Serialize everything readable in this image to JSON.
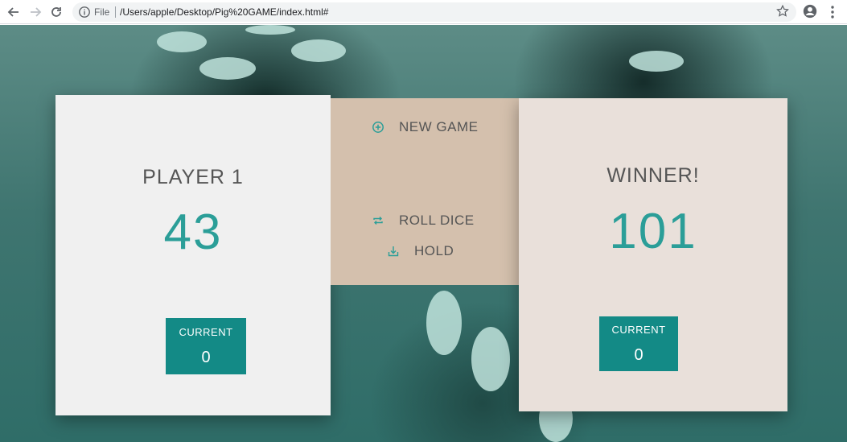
{
  "browser": {
    "file_label": "File",
    "url": "/Users/apple/Desktop/Pig%20GAME/index.html#"
  },
  "players": [
    {
      "name": "PLAYER 1",
      "score": "43",
      "current_label": "CURRENT",
      "current_value": "0",
      "active": false
    },
    {
      "name": "WINNER!",
      "score": "101",
      "current_label": "CURRENT",
      "current_value": "0",
      "winner": true
    }
  ],
  "controls": {
    "new_game": {
      "label": "NEW GAME",
      "icon": "add-circle-icon"
    },
    "roll_dice": {
      "label": "ROLL DICE",
      "icon": "loop-icon"
    },
    "hold": {
      "label": "HOLD",
      "icon": "download-icon"
    }
  },
  "colors": {
    "accent": "#2b9e98",
    "current_box": "#138a86",
    "left_panel": "#f0f0f0",
    "right_panel": "#e9e0da",
    "middle_panel": "#d4c0ad"
  }
}
